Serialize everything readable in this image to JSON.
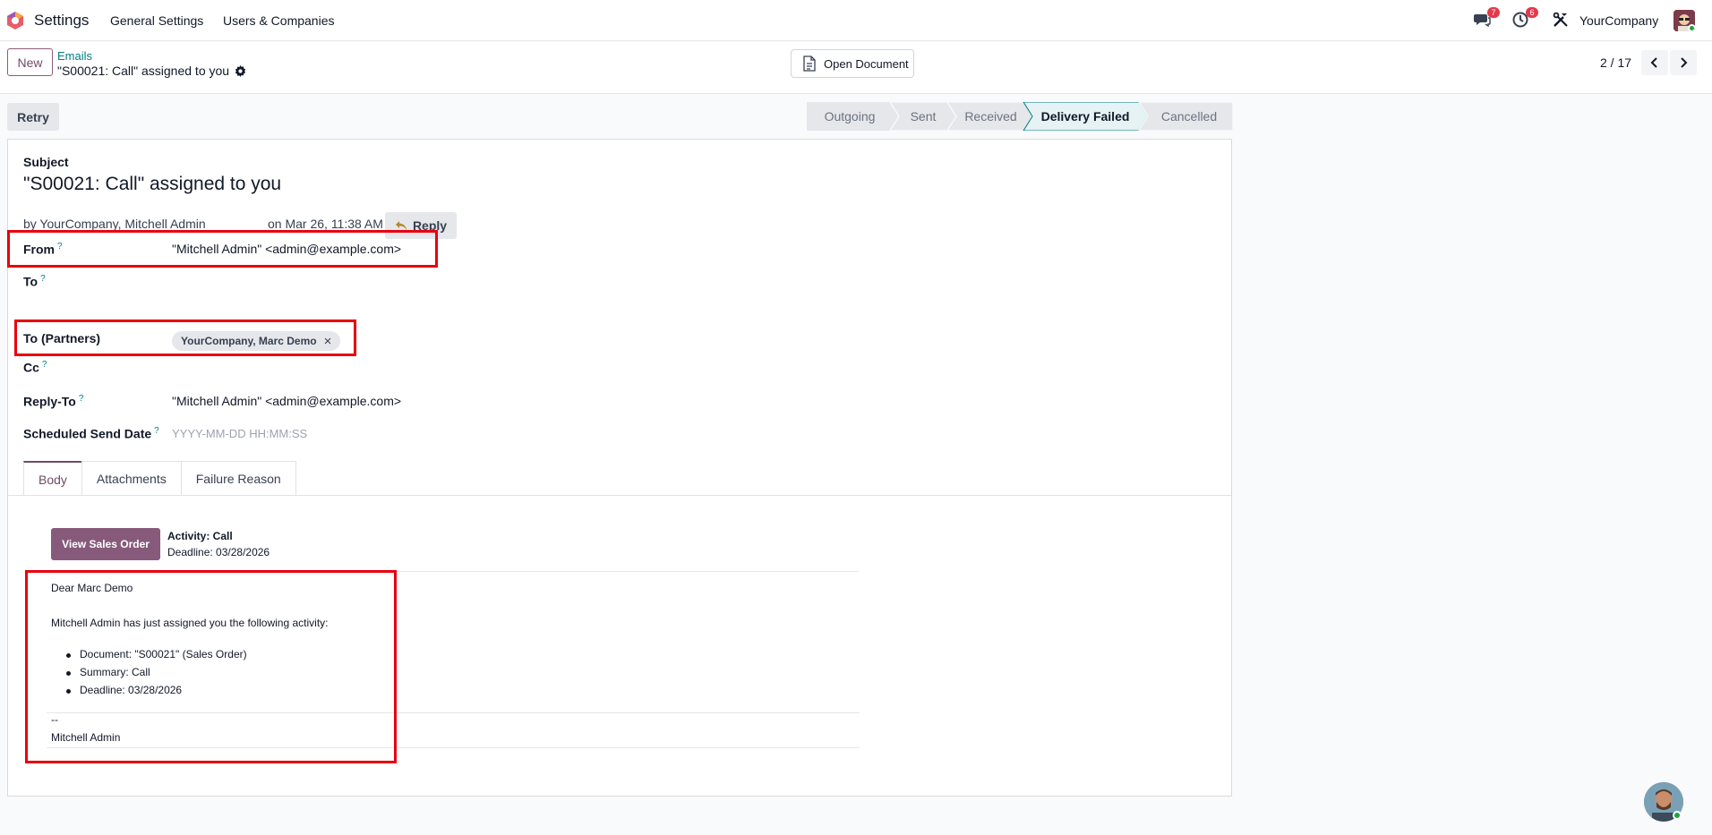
{
  "navbar": {
    "app_name": "Settings",
    "menu": [
      "General Settings",
      "Users & Companies"
    ],
    "messages_badge": "7",
    "activities_badge": "6",
    "company": "YourCompany"
  },
  "control": {
    "new_label": "New",
    "breadcrumb_parent": "Emails",
    "breadcrumb_current": "\"S00021: Call\" assigned to you",
    "open_document_label": "Open Document",
    "pager": "2 / 17"
  },
  "statusbar": {
    "retry_label": "Retry",
    "stages": [
      "Outgoing",
      "Sent",
      "Received",
      "Delivery Failed",
      "Cancelled"
    ],
    "active_stage": "Delivery Failed"
  },
  "form": {
    "subject_label": "Subject",
    "subject": "\"S00021: Call\" assigned to you",
    "by_line": "by YourCompany, Mitchell Admin",
    "on_line": "on Mar 26, 11:38 AM",
    "reply_label": "Reply",
    "from_label": "From",
    "from_value": "\"Mitchell Admin\" <admin@example.com>",
    "to_label": "To",
    "to_partners_label": "To (Partners)",
    "to_partners_tag": "YourCompany, Marc Demo",
    "cc_label": "Cc",
    "reply_to_label": "Reply-To",
    "reply_to_value": "\"Mitchell Admin\" <admin@example.com>",
    "scheduled_label": "Scheduled Send Date",
    "scheduled_placeholder": "YYYY-MM-DD HH:MM:SS",
    "help_mark": "?"
  },
  "tabs": [
    "Body",
    "Attachments",
    "Failure Reason"
  ],
  "email_body": {
    "view_button": "View Sales Order",
    "activity_title": "Activity: Call",
    "activity_deadline": "Deadline: 03/28/2026",
    "greeting": "Dear Marc Demo",
    "intro": "Mitchell Admin has just assigned you the following activity:",
    "items": [
      "Document: \"S00021\" (Sales Order)",
      "Summary: Call",
      "Deadline: 03/28/2026"
    ],
    "sig_sep": "--",
    "signature": "Mitchell Admin"
  },
  "colors": {
    "brand": "#714b67",
    "accent_teal": "#017e84",
    "highlight_red": "#e8000d"
  }
}
